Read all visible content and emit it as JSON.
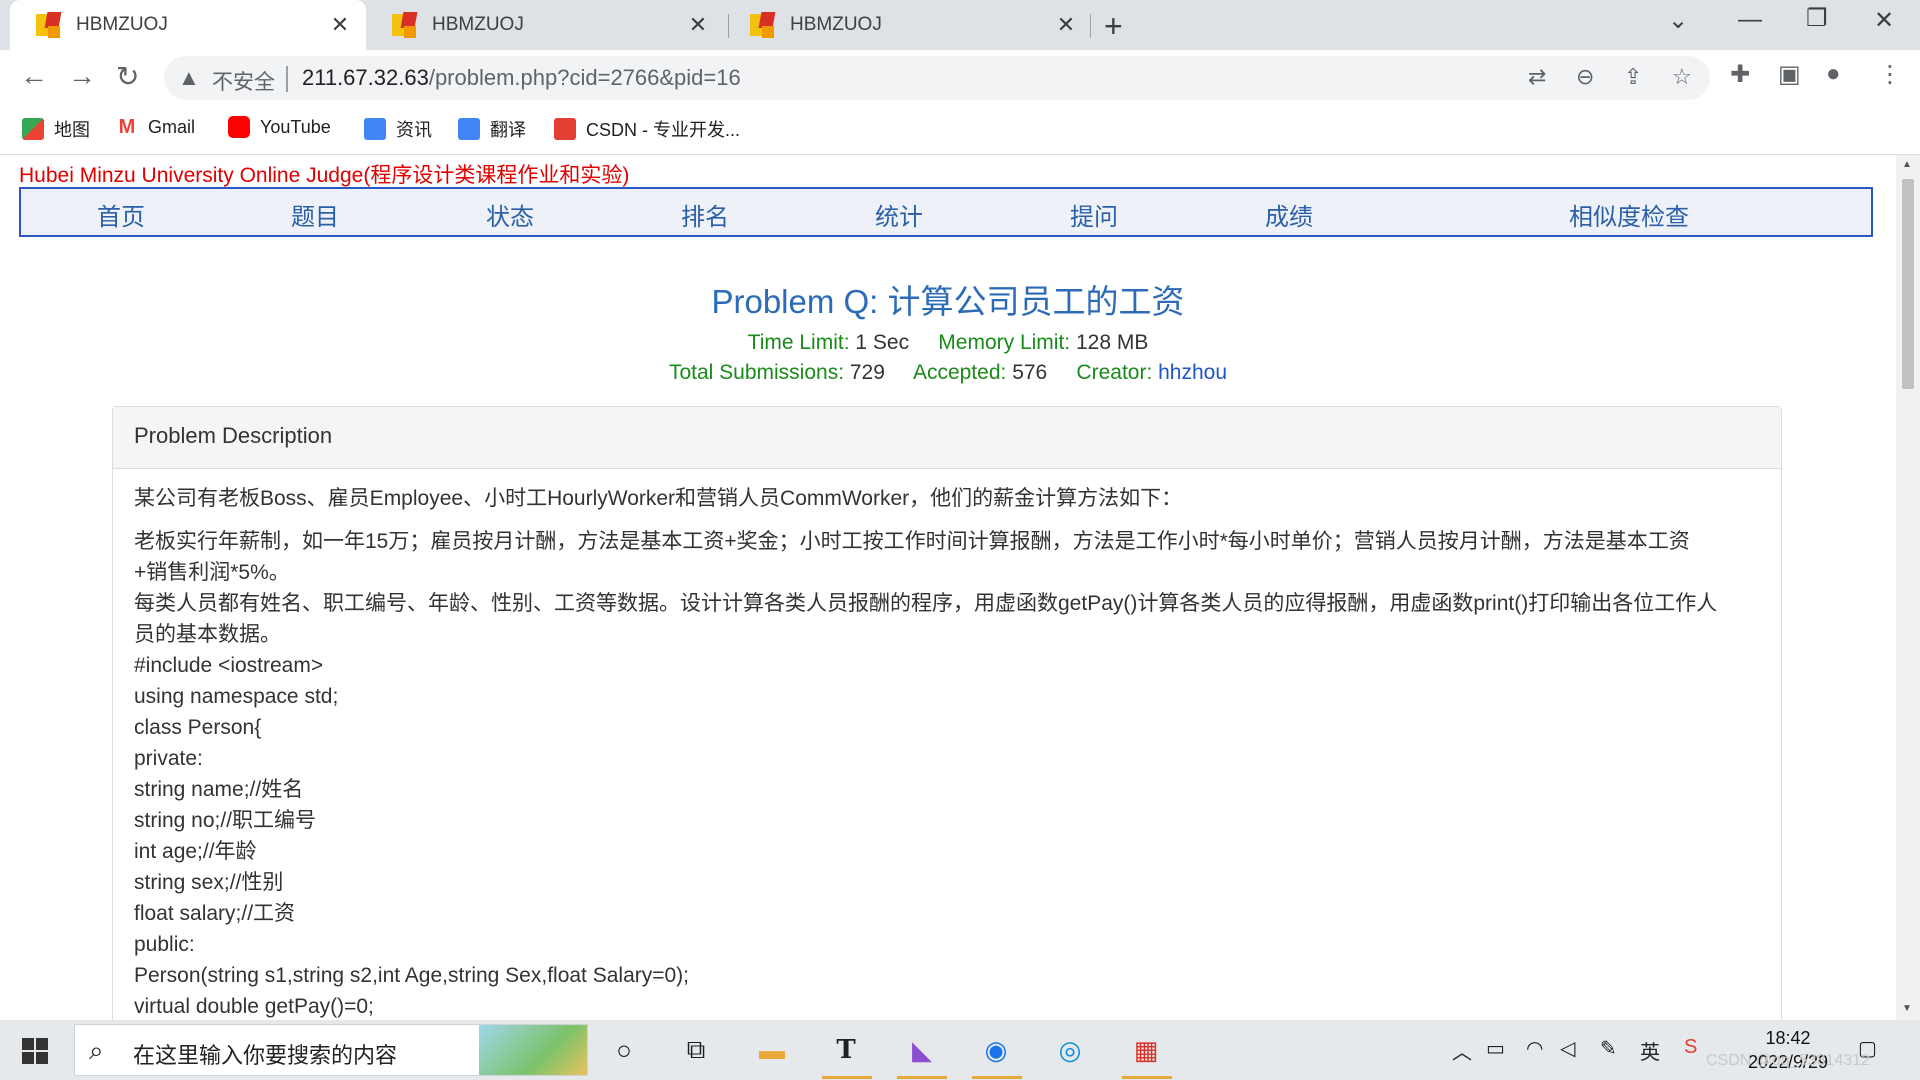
{
  "browser": {
    "tabs": [
      {
        "title": "HBMZUOJ",
        "active": true
      },
      {
        "title": "HBMZUOJ",
        "active": false
      },
      {
        "title": "HBMZUOJ",
        "active": false
      }
    ],
    "new_tab_label": "+",
    "omnibox": {
      "security_label": "不安全",
      "url_host": "211.67.32.63",
      "url_path": "/problem.php?cid=2766&pid=16"
    },
    "bookmarks": [
      {
        "label": "地图",
        "icon": "maps-icon"
      },
      {
        "label": "Gmail",
        "icon": "gmail-icon"
      },
      {
        "label": "YouTube",
        "icon": "youtube-icon"
      },
      {
        "label": "资讯",
        "icon": "news-icon"
      },
      {
        "label": "翻译",
        "icon": "translate-icon"
      },
      {
        "label": "CSDN - 专业开发...",
        "icon": "csdn-icon"
      }
    ]
  },
  "site": {
    "title": "Hubei Minzu University Online Judge(程序设计类课程作业和实验)",
    "menu": [
      "首页",
      "题目",
      "状态",
      "排名",
      "统计",
      "提问",
      "成绩",
      "相似度检查"
    ]
  },
  "problem": {
    "title": "Problem Q: 计算公司员工的工资",
    "time_limit_label": "Time Limit:",
    "time_limit": "1 Sec",
    "memory_limit_label": "Memory Limit:",
    "memory_limit": "128 MB",
    "total_submissions_label": "Total Submissions:",
    "total_submissions": "729",
    "accepted_label": "Accepted:",
    "accepted": "576",
    "creator_label": "Creator:",
    "creator": "hhzhou",
    "description_heading": "Problem Description",
    "description_intro": "某公司有老板Boss、雇员Employee、小时工HourlyWorker和营销人员CommWorker，他们的薪金计算方法如下：",
    "description_lines": [
      "老板实行年薪制，如一年15万；雇员按月计酬，方法是基本工资+奖金；小时工按工作时间计算报酬，方法是工作小时*每小时单价；营销人员按月计酬，方法是基本工资",
      "+销售利润*5%。",
      "每类人员都有姓名、职工编号、年龄、性别、工资等数据。设计计算各类人员报酬的程序，用虚函数getPay()计算各类人员的应得报酬，用虚函数print()打印输出各位工作人",
      "员的基本数据。",
      "#include <iostream>",
      "using namespace std;",
      "class Person{",
      "private:",
      "string name;//姓名",
      "string no;//职工编号",
      "int age;//年龄",
      "string sex;//性别",
      "float salary;//工资",
      "public:",
      "Person(string s1,string s2,int Age,string Sex,float Salary=0);",
      "virtual double getPay()=0;"
    ]
  },
  "taskbar": {
    "search_placeholder": "在这里输入你要搜索的内容",
    "ime_label": "英",
    "time": "18:42",
    "date": "2022/9/29",
    "watermark": "CSDN @qq_53814312"
  }
}
